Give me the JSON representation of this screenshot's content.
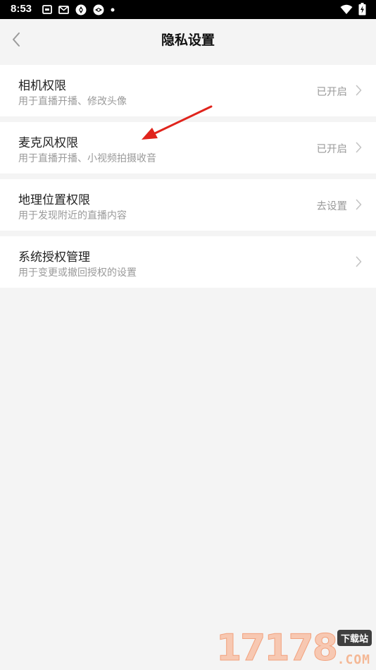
{
  "status_bar": {
    "time": "8:53",
    "icons": [
      "photo-notification-icon",
      "mail-notification-icon",
      "app-notification-icon",
      "app-notification-icon",
      "more-notifications-dot",
      "wifi-icon",
      "battery-charging-icon"
    ]
  },
  "header": {
    "title": "隐私设置",
    "back_icon": "chevron-left-icon"
  },
  "settings": {
    "items": [
      {
        "title": "相机权限",
        "subtitle": "用于直播开播、修改头像",
        "status": "已开启"
      },
      {
        "title": "麦克风权限",
        "subtitle": "用于直播开播、小视频拍摄收音",
        "status": "已开启"
      },
      {
        "title": "地理位置权限",
        "subtitle": "用于发现附近的直播内容",
        "status": "去设置"
      },
      {
        "title": "系统授权管理",
        "subtitle": "用于变更或撤回授权的设置",
        "status": ""
      }
    ]
  },
  "annotation": {
    "type": "red-arrow",
    "color": "#e0241c"
  },
  "watermark": {
    "digits": "17178",
    "badge": "下载站",
    "suffix": ".COM"
  },
  "colors": {
    "background": "#f4f4f4",
    "card": "#ffffff",
    "title_text": "#222222",
    "secondary_text": "#9a9a9a"
  }
}
